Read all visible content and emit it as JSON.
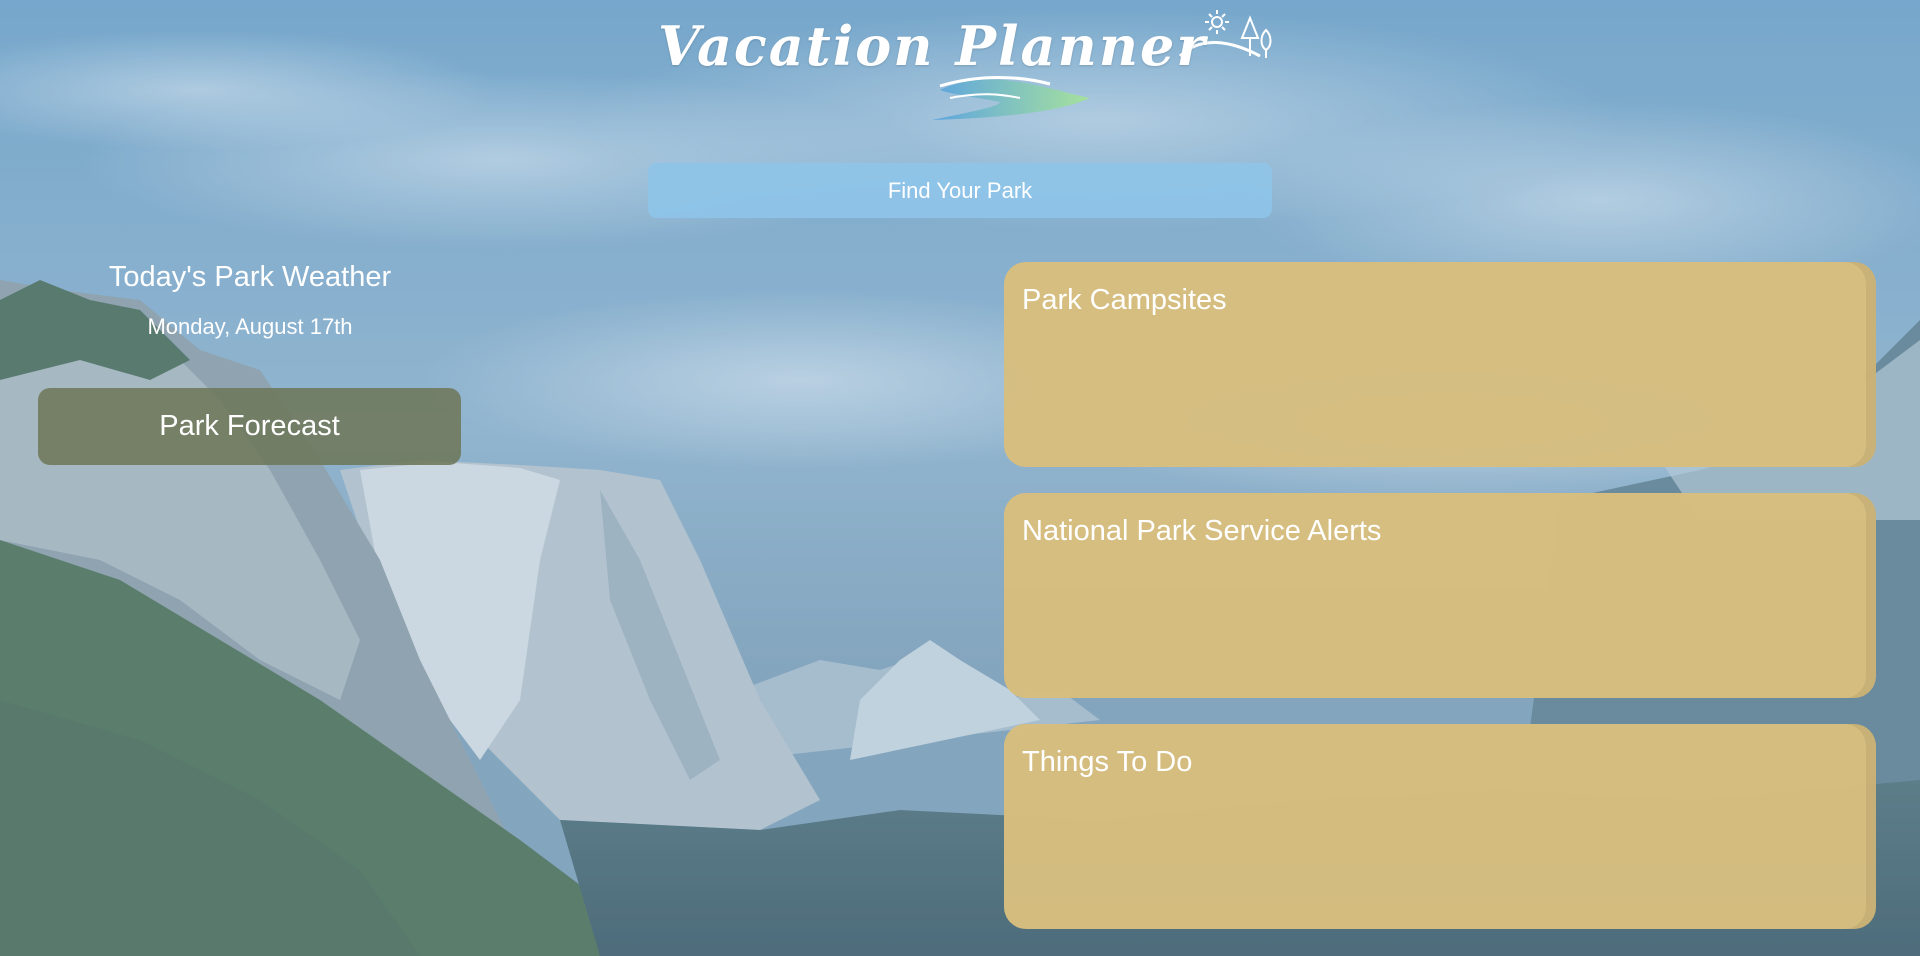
{
  "header": {
    "logo_text": "Vacation Planner",
    "logo_icons": [
      "sun-icon",
      "tree-icon",
      "river-icon"
    ]
  },
  "search": {
    "find_park_label": "Find Your Park"
  },
  "weather": {
    "title": "Today's Park Weather",
    "date": "Monday, August 17th",
    "forecast_label": "Park Forecast"
  },
  "cards": [
    {
      "title": "Park Campsites"
    },
    {
      "title": "National Park Service Alerts"
    },
    {
      "title": "Things To Do"
    }
  ],
  "colors": {
    "find_button": "#8EC4E8",
    "forecast_button": "#6E785A",
    "card_background": "#D6BE7E",
    "text": "#FFFFFF"
  }
}
